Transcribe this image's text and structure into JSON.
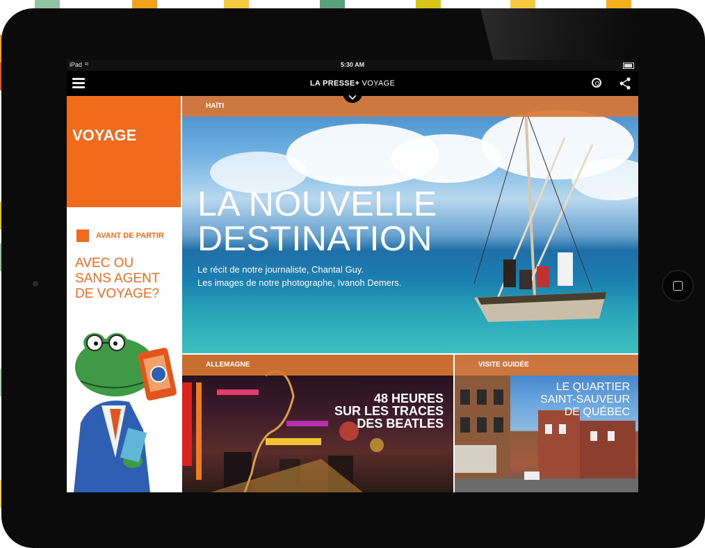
{
  "colors": {
    "accent": "#f26b1d",
    "section_bar": "#d87634",
    "navbar": "#000000",
    "bezel": "#0b0b0b"
  },
  "status_bar": {
    "carrier": "iPad",
    "wifi_icon": "wifi-icon",
    "time": "5:30 AM",
    "battery_icon": "battery-icon"
  },
  "nav": {
    "menu_icon": "menu-icon",
    "brand_bold": "LA PRESSE+",
    "brand_section": " VOYAGE",
    "related_icon": "related-icon",
    "share_icon": "share-icon",
    "chevron_icon": "chevron-down-icon"
  },
  "sidebar": {
    "section_title": "VOYAGE",
    "kicker": "AVANT DE PARTIR",
    "headline_lines": [
      "AVEC OU",
      "SANS AGENT",
      "DE VOYAGE?"
    ]
  },
  "hero": {
    "section": "HAÏTI",
    "title_lines": [
      "LA NOUVELLE",
      "DESTINATION"
    ],
    "subtitle_lines": [
      "Le récit de notre journaliste, Chantal Guy.",
      "Les images de notre photographe, Ivanoh Demers."
    ]
  },
  "tiles": [
    {
      "section": "ALLEMAGNE",
      "title_lines": [
        "48 HEURES",
        "SUR LES TRACES",
        "DES BEATLES"
      ]
    },
    {
      "section": "VISITE GUIDÉE",
      "title_lines": [
        "LE QUARTIER",
        "SAINT-SAUVEUR",
        "DE QUÉBEC"
      ]
    }
  ]
}
